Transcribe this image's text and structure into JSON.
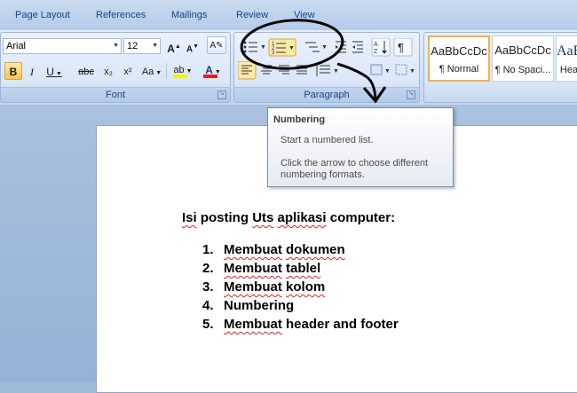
{
  "tabs": [
    "Page Layout",
    "References",
    "Mailings",
    "Review",
    "View"
  ],
  "font_group": {
    "label": "Font",
    "font_name": "Arial",
    "font_size": "12",
    "grow_glyph": "A",
    "shrink_glyph": "A",
    "bold": "B",
    "italic": "I",
    "underline": "U",
    "strike": "abc",
    "subscript": "x₂",
    "superscript": "x²",
    "change_case": "Aa",
    "highlight": "ab",
    "font_color": "A"
  },
  "paragraph_group": {
    "label": "Paragraph"
  },
  "styles": [
    {
      "sample": "AaBbCcDc",
      "name": "¶ Normal",
      "selected": true
    },
    {
      "sample": "AaBbCcDc",
      "name": "¶ No Spaci...",
      "selected": false
    },
    {
      "sample": "AaB",
      "name": "Hea",
      "selected": false
    }
  ],
  "tooltip": {
    "title": "Numbering",
    "line1": "Start a numbered list.",
    "line2": "Click the arrow to choose different",
    "line3": "numbering formats."
  },
  "document": {
    "heading_parts": [
      "Isi",
      " posting ",
      "Uts",
      " ",
      "aplikasi",
      " computer:"
    ],
    "list": [
      {
        "num": "1.",
        "parts": [
          "Membuat",
          " ",
          "dokumen"
        ]
      },
      {
        "num": "2.",
        "parts": [
          "Membuat",
          " ",
          "tablel"
        ]
      },
      {
        "num": "3.",
        "parts": [
          "Membuat",
          " ",
          "kolom"
        ]
      },
      {
        "num": "4.",
        "parts": [
          "Numbering"
        ]
      },
      {
        "num": "5.",
        "parts": [
          "Membuat",
          " header and footer"
        ]
      }
    ]
  },
  "colors": {
    "highlight_bar": "#f5f500",
    "font_color_bar": "#e02020",
    "annotation": "#000000"
  }
}
